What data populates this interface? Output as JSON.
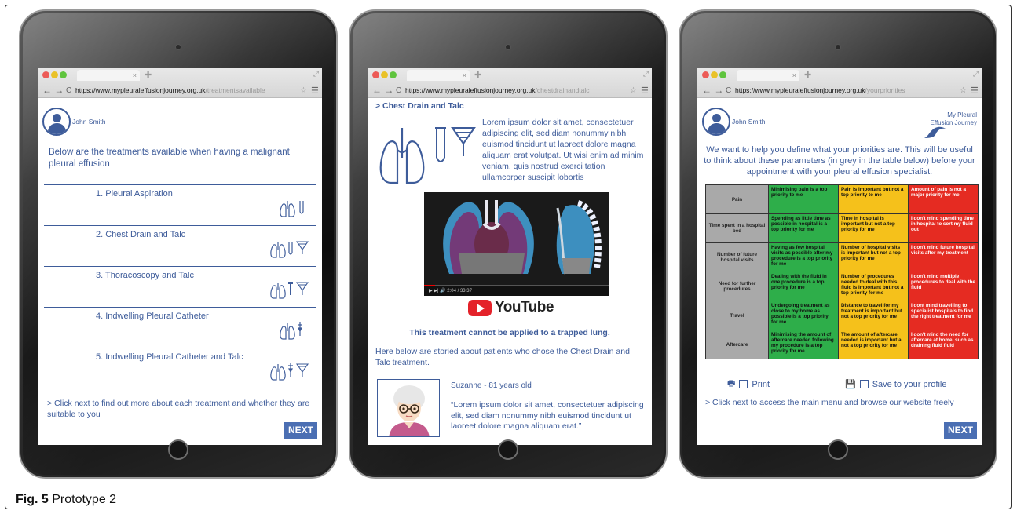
{
  "caption": {
    "label": "Fig. 5",
    "text": " Prototype 2"
  },
  "tablet1": {
    "tab_close": "×",
    "url_base": "https://www.mypleuraleffusionjourney.org.uk",
    "url_path": "/treatmentsavailable",
    "user": "John Smith",
    "intro": "Below are the treatments available when having a malignant pleural effusion",
    "treatments": [
      {
        "label": "1. Pleural Aspiration",
        "icons": "🫁𝌆"
      },
      {
        "label": "2. Chest Drain and Talc",
        "icons": "🫁"
      },
      {
        "label": "3. Thoracoscopy and Talc",
        "icons": "🫁"
      },
      {
        "label": "4. Indwelling Pleural Catheter",
        "icons": "🫁"
      },
      {
        "label": "5. Indwelling Pleural Catheter and Talc",
        "icons": "🫁"
      }
    ],
    "footer": "> Click next to find out more about each treatment and whether they are suitable to you",
    "next": "NEXT"
  },
  "tablet2": {
    "tab_close": "×",
    "url_base": "https://www.mypleuraleffusionjourney.org.uk",
    "url_path": "/chestdrainandtalc",
    "title": "> Chest Drain and Talc",
    "lorem": "Lorem ipsum dolor sit amet, consectetuer adipiscing elit, sed diam nonummy nibh euismod tincidunt ut laoreet dolore magna aliquam erat volutpat. Ut wisi enim ad minim veniam, quis nostrud exerci tation ullamcorper suscipit lobortis",
    "video_time": "2:04 / 33:37",
    "youtube": "YouTube",
    "warning": "This treatment cannot be applied to a trapped lung.",
    "here": "Here below are storied about patients who chose the Chest Drain and Talc treatment.",
    "patient_name": "Suzanne - 81 years old",
    "quote": "“Lorem ipsum dolor sit amet, consectetuer adipiscing elit, sed diam nonummy nibh euismod tincidunt ut laoreet dolore magna aliquam erat.”"
  },
  "tablet3": {
    "tab_close": "×",
    "url_base": "https://www.mypleuraleffusionjourney.org.uk",
    "url_path": "/yourpriorities",
    "user": "John Smith",
    "brand": "My Pleural Effusion Journey",
    "intro": "We want to help you define what your priorities are. This will be useful to think about these parameters (in grey in the table below) before your appointment with your pleural effusion specialist.",
    "rows": [
      {
        "h": "Pain",
        "g": "Minimising pain is a top priority to me",
        "y": "Pain is important but not a top priority to me",
        "r": "Amount of pain is not a major priority for me"
      },
      {
        "h": "Time spent in a hospital bed",
        "g": "Spending as little time as possible in hospital is a top priority for me",
        "y": "Time in hospital is important but not a top priority for me",
        "r": "I don't mind spending time in hospital to sort my fluid out"
      },
      {
        "h": "Number of future hospital visits",
        "g": "Having as few hospital visits as possible after my procedure is a top priority for me",
        "y": "Number of hospital visits is important but not a top priority for me",
        "r": "I don't mind future hospital visits after my treatment"
      },
      {
        "h": "Need for further procedures",
        "g": "Dealing with the fluid in one procedure is a top priority for me",
        "y": "Number of procedures needed to deal with this fluid is important but not a top priority for me",
        "r": "I don't mind multiple procedures to deal with the fluid"
      },
      {
        "h": "Travel",
        "g": "Undergoing treatment as close to my home as possible is a top priority for me",
        "y": "Distance to travel for my treatment is important but not a top priority for me",
        "r": "I dont mind travelling to specialist hospitals to find the right treatment for me"
      },
      {
        "h": "Aftercare",
        "g": "Minimising the amount of aftercare needed following my procedure is a top priority for me",
        "y": "The amount of aftercare needed is important but a not a top priority for me",
        "r": "I don't mind the need for aftercare at home, such as draining fluid fluid"
      }
    ],
    "print": "Print",
    "save": "Save to your profile",
    "footer": "> Click next to access the main menu and browse our website freely",
    "next": "NEXT"
  },
  "colors": {
    "accent": "#3e5c9a",
    "button": "#4b6fb3",
    "green": "#2eae4a",
    "yellow": "#f5c11b",
    "red": "#e52b22",
    "grey": "#a9a9a9"
  }
}
